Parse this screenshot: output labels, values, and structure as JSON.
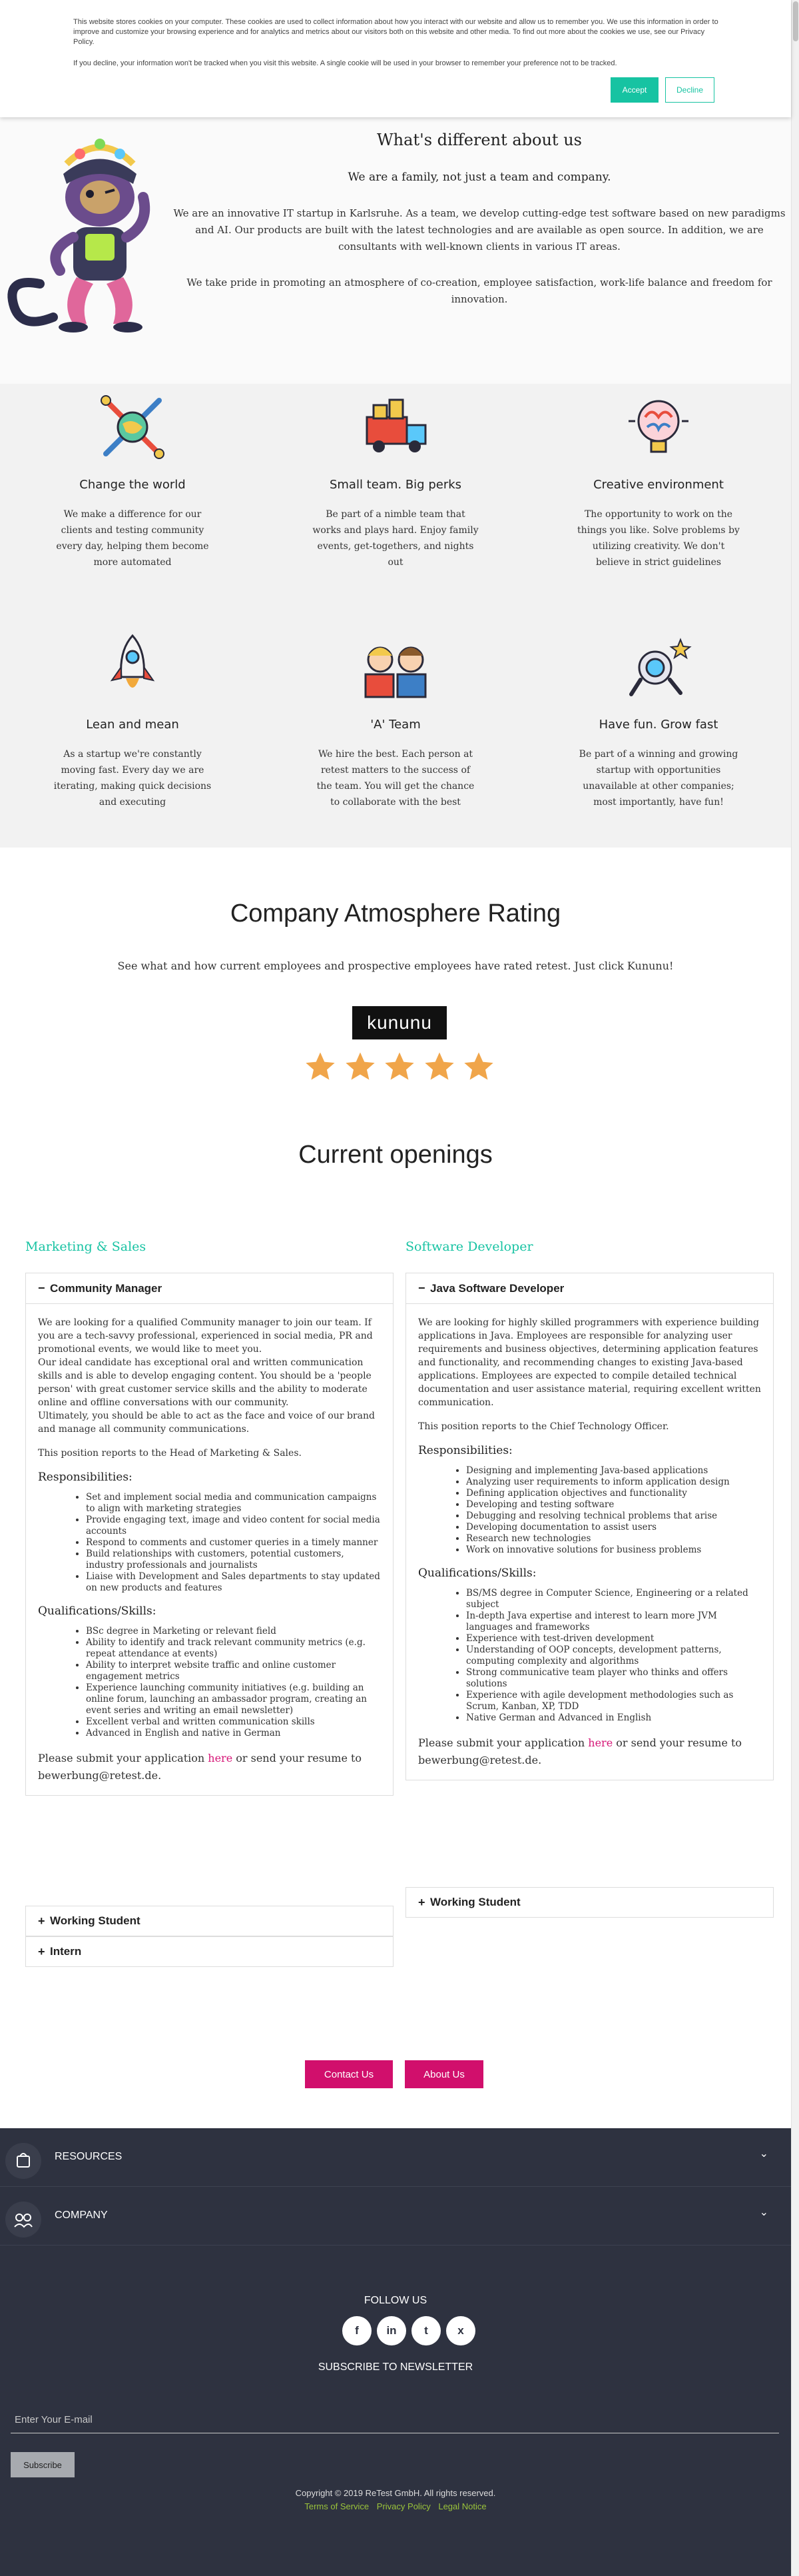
{
  "cookie": {
    "text1": "This website stores cookies on your computer. These cookies are used to collect information about how you interact with our website and allow us to remember you. We use this information in order to improve and customize your browsing experience and for analytics and metrics about our visitors both on this website and other media. To find out more about the cookies we use, see our Privacy Policy.",
    "text2": "If you decline, your information won't be tracked when you visit this website. A single cookie will be used in your browser to remember your preference not to be tracked.",
    "accept": "Accept",
    "decline": "Decline"
  },
  "about": {
    "title": "What's different about us",
    "lead": "We are a family, not just a team and company.",
    "para1": "We are an innovative IT startup in Karlsruhe. As a team, we develop cutting-edge test software based on new paradigms and AI. Our products are built with the latest technologies and are available as open source. In addition, we are consultants with well-known clients in various IT areas.",
    "para2": "We take pride in promoting an atmosphere of co-creation, employee satisfaction, work-life balance and freedom for innovation."
  },
  "features": [
    {
      "title": "Change the world",
      "icon": "tools-icon",
      "text": "We make a difference for our clients and testing community every day, helping them become more automated"
    },
    {
      "title": "Small team. Big perks",
      "icon": "truck-gift-icon",
      "text": "Be part of a nimble team that works and plays hard. Enjoy family events, get-togethers, and nights out"
    },
    {
      "title": "Creative environment",
      "icon": "brain-bulb-icon",
      "text": "The opportunity to work on the things you like. Solve problems by utilizing creativity. We don't believe in strict guidelines"
    },
    {
      "title": "Lean and mean",
      "icon": "rocket-icon",
      "text": "As a startup we're constantly moving fast. Every day we are iterating, making quick decisions and executing"
    },
    {
      "title": "'A' Team",
      "icon": "team-icon",
      "text": "We hire the best. Each person at retest matters to the success of the team. You will get the chance to collaborate with the best"
    },
    {
      "title": "Have fun. Grow fast",
      "icon": "astronaut-icon",
      "text": "Be part of a winning and growing startup with opportunities unavailable at other companies; most importantly, have fun!"
    }
  ],
  "rating": {
    "title": "Company Atmosphere Rating",
    "subtitle": "See what and how current employees and prospective employees have rated retest. Just click Kununu!",
    "kununu": "kununu",
    "stars": 5
  },
  "openings": {
    "title": "Current openings",
    "marketing": {
      "heading": "Marketing & Sales",
      "job": "Community Manager",
      "intro": "We are looking for a qualified Community manager to join our team. If you are a tech-savvy professional, experienced in social media, PR and promotional events, we would like to meet you.",
      "intro2": "Our ideal candidate has exceptional oral and written communication skills and is able to develop engaging content. You should be a 'people person' with great customer service skills and the ability to moderate online and offline conversations with our community.",
      "intro3": "Ultimately, you should be able to act as the face and voice of our brand and manage all community communications.",
      "reports": "This position reports to the Head of Marketing & Sales.",
      "resp_title": "Responsibilities:",
      "responsibilities": [
        "Set and implement social media and communication campaigns to align with marketing strategies",
        "Provide engaging text, image and video content for social media accounts",
        "Respond to comments and customer queries in a timely manner",
        "Build relationships with customers, potential customers, industry professionals and journalists",
        "Liaise with Development and Sales departments to stay updated on new products and features"
      ],
      "qual_title": "Qualifications/Skills:",
      "qualifications": [
        "BSc degree in Marketing or relevant field",
        "Ability to identify and track relevant community metrics (e.g. repeat attendance at events)",
        "Ability to interpret website traffic and online customer engagement metrics",
        "Experience launching community initiatives (e.g. building an online forum, launching an ambassador program, creating an event series and writing an email newsletter)",
        "Excellent verbal and written communication skills",
        "Advanced in English and native in German"
      ],
      "apply_pre": "Please submit your application ",
      "apply_link": "here",
      "apply_post": " or send your resume to bewerbung@retest.de.",
      "sub1": "Working Student",
      "sub2": "Intern"
    },
    "software": {
      "heading": "Software Developer",
      "job": "Java Software Developer",
      "intro": "We are looking for highly skilled programmers with experience building applications in Java. Employees are responsible for analyzing user requirements and business objectives, determining application features and functionality, and recommending changes to existing Java-based applications. Employees are expected to compile detailed technical documentation and user assistance material, requiring excellent written communication.",
      "reports": "This position reports to the Chief Technology Officer.",
      "resp_title": "Responsibilities:",
      "responsibilities": [
        "Designing and implementing Java-based applications",
        "Analyzing user requirements to inform application design",
        "Defining application objectives and functionality",
        "Developing and testing software",
        "Debugging and resolving technical problems that arise",
        "Developing documentation to assist users",
        "Research new technologies",
        "Work on innovative solutions for business problems"
      ],
      "qual_title": "Qualifications/Skills:",
      "qualifications": [
        "BS/MS degree in Computer Science, Engineering or a related subject",
        "In-depth Java expertise and interest to learn more JVM languages and frameworks",
        "Experience with test-driven development",
        "Understanding of OOP concepts, development patterns, computing complexity and algorithms",
        "Strong communicative team player who thinks and offers solutions",
        "Experience with agile development methodologies such as Scrum, Kanban, XP, TDD",
        "Native German and Advanced in English"
      ],
      "apply_pre": "Please submit your application ",
      "apply_link": "here",
      "apply_post": " or send your resume to bewerbung@retest.de.",
      "sub1": "Working Student"
    }
  },
  "buttons": {
    "contact": "Contact Us",
    "about": "About Us"
  },
  "footer": {
    "resources": "RESOURCES",
    "company": "COMPANY",
    "follow": "FOLLOW US",
    "socials": [
      "f",
      "in",
      "t",
      "x"
    ],
    "newsletter": "SUBSCRIBE TO NEWSLETTER",
    "email_placeholder": "Enter Your E-mail",
    "subscribe": "Subscribe",
    "copyright": "Copyright © 2019 ReTest GmbH. All rights reserved.",
    "links": [
      "Terms of Service",
      "Privacy Policy",
      "Legal Notice"
    ]
  },
  "colors": {
    "accent": "#17c3a2",
    "pink": "#d10f6c",
    "footer": "#2e3240",
    "star": "#f0a54a"
  }
}
